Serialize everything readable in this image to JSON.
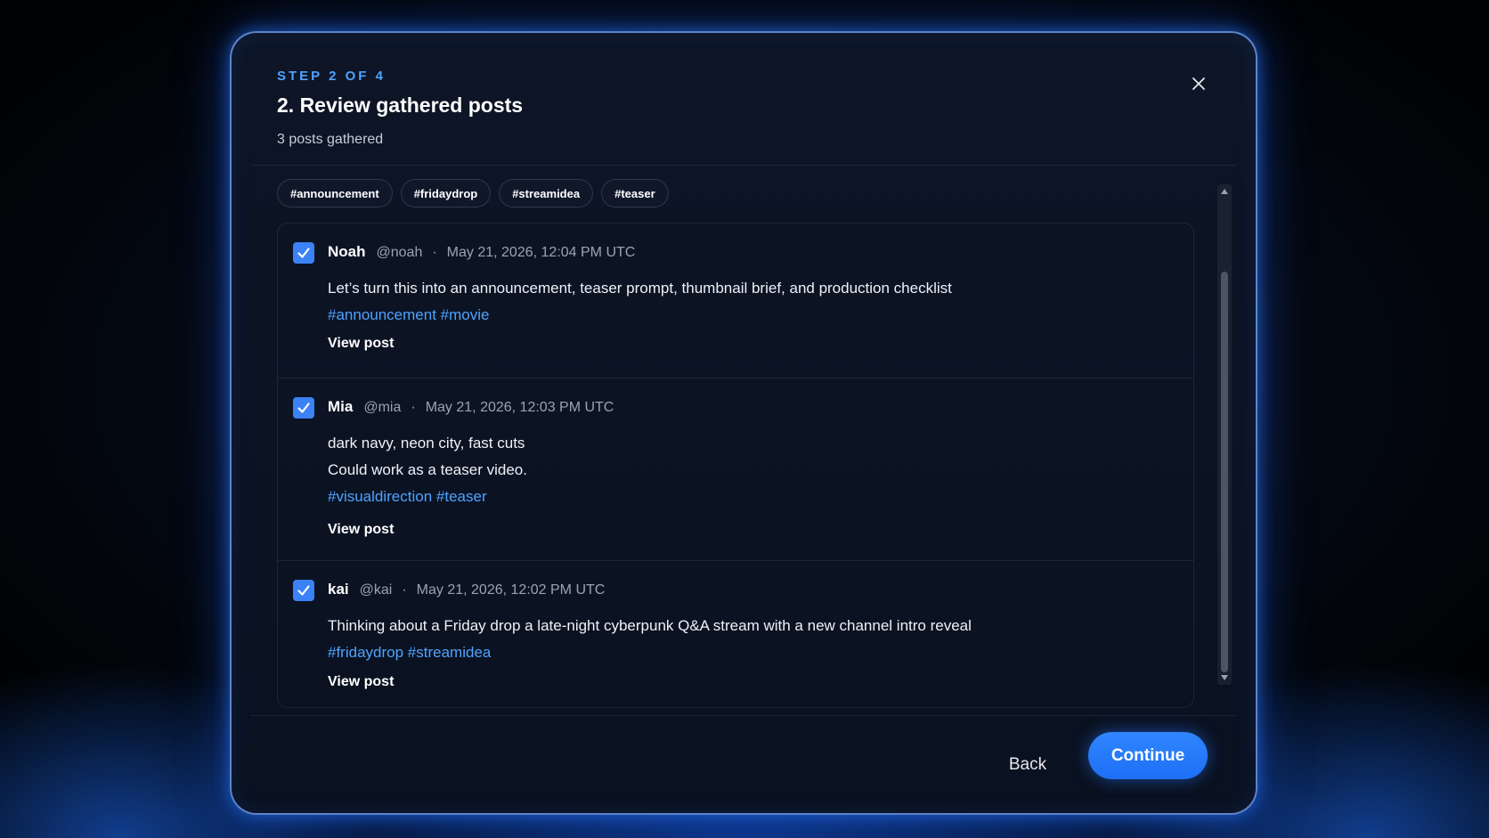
{
  "modal": {
    "step_label": "STEP 2 OF 4",
    "title": "2. Review gathered posts",
    "subtitle": "3 posts gathered",
    "close_icon": "close-icon"
  },
  "filter_tags": [
    "#announcement",
    "#fridaydrop",
    "#streamidea",
    "#teaser"
  ],
  "posts": [
    {
      "checked": true,
      "author": "Noah",
      "handle": "@noah",
      "separator": "·",
      "time": "May 21, 2026, 12:04 PM UTC",
      "lines": [
        "Let’s turn this into an announcement, teaser prompt, thumbnail brief, and production checklist"
      ],
      "hashtags": [
        "#announcement",
        "#movie"
      ],
      "view_label": "View post"
    },
    {
      "checked": true,
      "author": "Mia",
      "handle": "@mia",
      "separator": "·",
      "time": "May 21, 2026, 12:03 PM UTC",
      "lines": [
        "dark navy, neon city, fast cuts",
        "Could work as a teaser video."
      ],
      "hashtags": [
        "#visualdirection",
        "#teaser"
      ],
      "view_label": "View post"
    },
    {
      "checked": true,
      "author": "kai",
      "handle": "@kai",
      "separator": "·",
      "time": "May 21, 2026, 12:02 PM UTC",
      "lines": [
        "Thinking about a Friday drop a late-night cyberpunk Q&A stream with a new channel intro reveal"
      ],
      "hashtags": [
        "#fridaydrop",
        "#streamidea"
      ],
      "view_label": "View post"
    }
  ],
  "footer": {
    "back_label": "Back",
    "continue_label": "Continue"
  },
  "colors": {
    "accent": "#3b82f6",
    "hashtag": "#4ea3ff",
    "background": "#0a1120",
    "glow": "#1e6ff5"
  }
}
